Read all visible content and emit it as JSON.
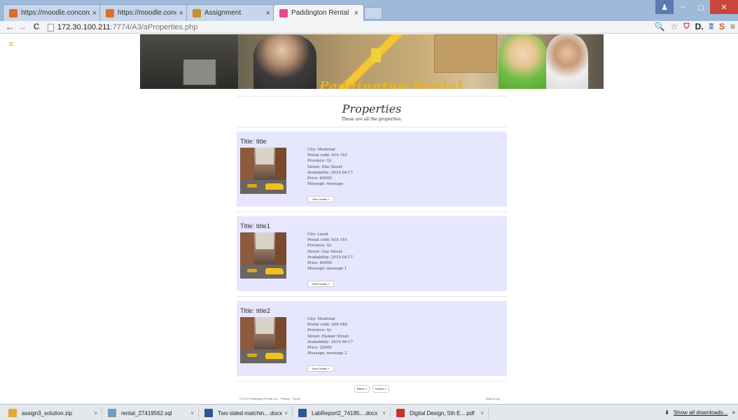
{
  "browser": {
    "tabs": [
      {
        "label": "https://moodle.concordia",
        "icon": "moodle-icon",
        "color": "#e06c2a"
      },
      {
        "label": "https://moodle.concordia",
        "icon": "moodle-icon",
        "color": "#e06c2a"
      },
      {
        "label": "Assignment",
        "icon": "assignment-icon",
        "color": "#c6902d"
      },
      {
        "label": "Paddington Rental",
        "icon": "paddington-icon",
        "color": "#e8478c",
        "active": true
      }
    ],
    "close_glyph": "×",
    "url_host": "172.30.100.211",
    "url_path": ":7774/A3/aProperties.php",
    "nav": {
      "back": "←",
      "forward": "→",
      "reload": "C"
    },
    "extensions": [
      "🔍",
      "☆",
      "D.",
      "ʬ",
      "S",
      "≡"
    ],
    "window": {
      "user": "♟",
      "minimize": "–",
      "maximize": "◻",
      "close": "✕"
    }
  },
  "site": {
    "menu_glyph": "≡",
    "banner_text": "Paddington Rental",
    "title": "Properties",
    "subtitle": "These are all the properties.",
    "properties": [
      {
        "title": "Title: title",
        "details": [
          "City: Montreal",
          "Postal code: h1h 1h1",
          "Province: Qc",
          "Street: Elm Street",
          "Availability: 2015-04-17",
          "Price: 65000",
          "Message: message"
        ],
        "button": "View Details »"
      },
      {
        "title": "Title: title1",
        "details": [
          "City: Laval",
          "Postal code: h1h 1h1",
          "Province: Qc",
          "Street: Guy Street",
          "Availability: 2015-04-17",
          "Price: 85000",
          "Message: message 1"
        ],
        "button": "View Details »"
      },
      {
        "title": "Title: title2",
        "details": [
          "City: Montreal",
          "Postal code: h0h 0h0",
          "Province: Qc",
          "Street: Elemer Street",
          "Availability: 2015-04-17",
          "Price: 25000",
          "Message: message 2"
        ],
        "button": "View Details »"
      }
    ],
    "pager": {
      "more": "More »",
      "home": "Home »"
    },
    "footer": {
      "copyright": "© 2014 Paddington Rental, Inc. · Privacy · Terms",
      "back_to_top": "Back to top"
    }
  },
  "downloads": {
    "items": [
      {
        "name": "assign3_solution.zip",
        "icon": "zip-icon",
        "color": "#e0a82e"
      },
      {
        "name": "rental_27419562.sql",
        "icon": "sql-file-icon",
        "color": "#6aa0c8"
      },
      {
        "name": "Two sided matchin....docx",
        "icon": "word-icon",
        "color": "#2b5797"
      },
      {
        "name": "LabReport2_74195....docx",
        "icon": "word-icon",
        "color": "#2b5797"
      },
      {
        "name": "Digital Design, 5th E....pdf",
        "icon": "pdf-icon",
        "color": "#c8312a"
      }
    ],
    "arrow_glyph": "˅",
    "show_all": "Show all downloads...",
    "show_all_glyph": "⬇",
    "close_glyph": "×"
  },
  "colors": {
    "card_bg": "#e6e6ff",
    "tabbar_bg": "#9fb9d9",
    "accent_menu": "#e0b400",
    "banner_text": "#e7b421"
  }
}
